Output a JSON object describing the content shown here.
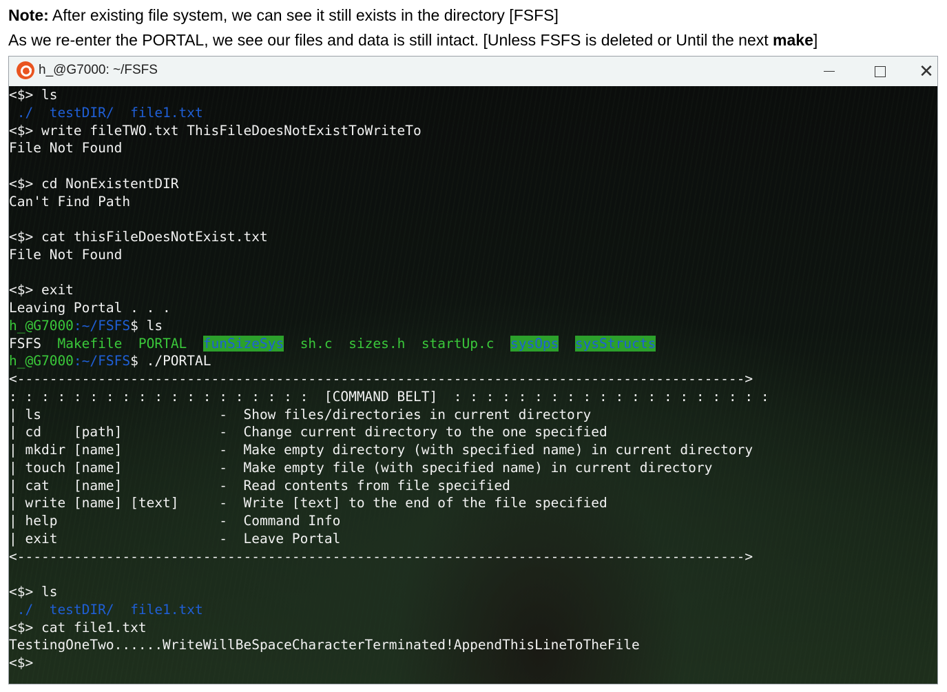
{
  "note": {
    "line1_bold": "Note:",
    "line1_text": " After existing file system, we can see it still exists in the directory [FSFS]",
    "line2_text": "As we re-enter the PORTAL, we see our files and data is still intact. [Unless FSFS is deleted or Until the next ",
    "line2_bold": "make",
    "line2_end": "]"
  },
  "window": {
    "title": "h_@G7000: ~/FSFS",
    "icons": {
      "app": "ubuntu-logo-icon",
      "minimize": "minimize-icon",
      "maximize": "maximize-icon",
      "close": "close-icon"
    }
  },
  "terminal": {
    "colors": {
      "directory": "#1f5fd6",
      "executable": "#3ac83a",
      "prompt_user": "#3ac83a",
      "highlight_bg": "#2ca02c",
      "text": "#f2f2f2"
    },
    "lines": [
      "<$> ls",
      " ./  testDIR/  file1.txt",
      "<$> write fileTWO.txt ThisFileDoesNotExistToWriteTo",
      "File Not Found",
      "",
      "<$> cd NonExistentDIR",
      "Can't Find Path",
      "",
      "<$> cat thisFileDoesNotExist.txt",
      "File Not Found",
      "",
      "<$> exit",
      "Leaving Portal . . .",
      {
        "user": "h_@G7000",
        "path": ":~/FSFS",
        "cmd": "$ ls"
      },
      {
        "ls": [
          "FSFS",
          "Makefile",
          "PORTAL",
          "funSizeSys",
          "sh.c",
          "sizes.h",
          "startUp.c",
          "sysOps",
          "sysStructs"
        ]
      },
      {
        "user": "h_@G7000",
        "path": ":~/FSFS",
        "cmd": "$ ./PORTAL"
      },
      "<------------------------------------------------------------------------------------------>",
      ": : : : : : : : : : : : : : : : : : :  [COMMAND BELT]  : : : : : : : : : : : : : : : : : : : :",
      "| ls                      -  Show files/directories in current directory",
      "| cd    [path]            -  Change current directory to the one specified",
      "| mkdir [name]            -  Make empty directory (with specified name) in current directory",
      "| touch [name]            -  Make empty file (with specified name) in current directory",
      "| cat   [name]            -  Read contents from file specified",
      "| write [name] [text]     -  Write [text] to the end of the file specified",
      "| help                    -  Command Info",
      "| exit                    -  Leave Portal",
      "<------------------------------------------------------------------------------------------>",
      "",
      "<$> ls",
      " ./  testDIR/  file1.txt",
      "<$> cat file1.txt",
      "TestingOneTwo......WriteWillBeSpaceCharacterTerminated!AppendThisLineToTheFile",
      "<$>"
    ]
  }
}
